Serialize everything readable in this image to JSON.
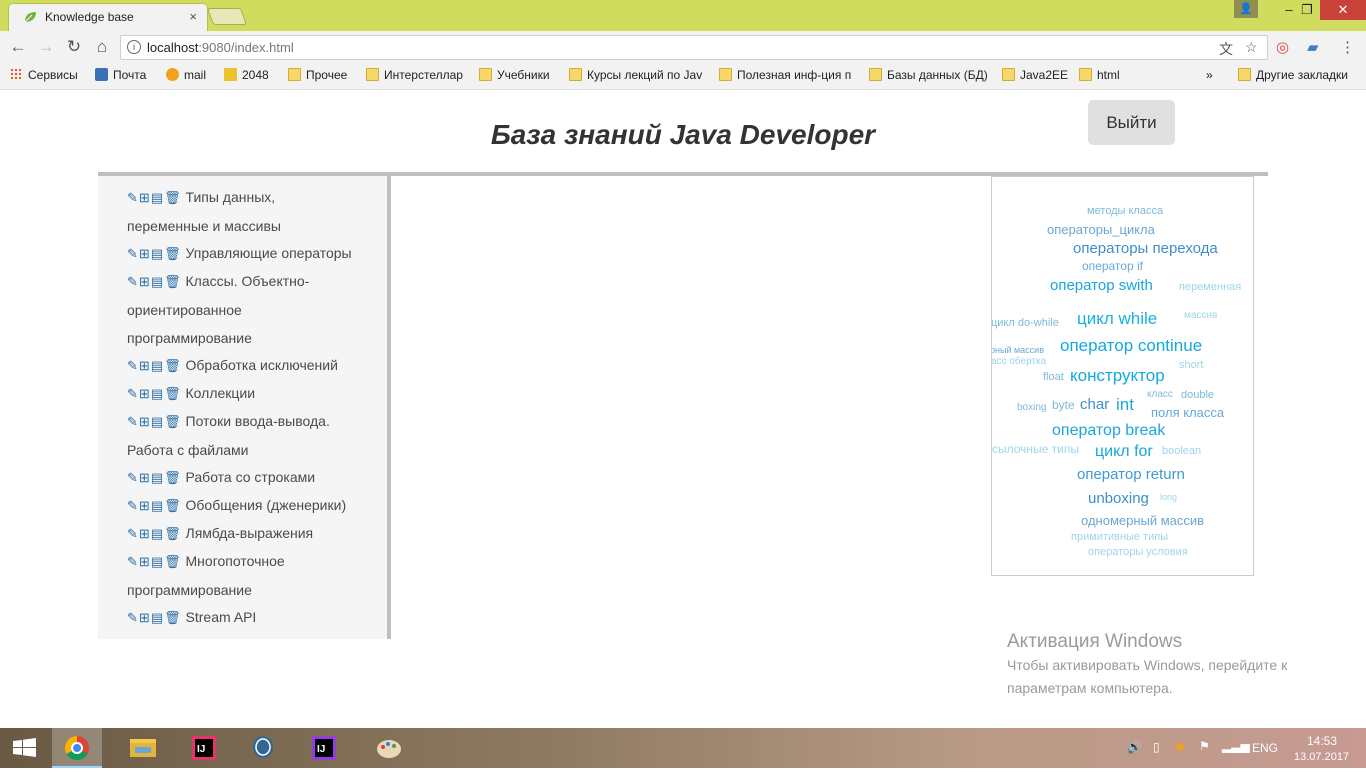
{
  "browser": {
    "tab_title": "Knowledge base",
    "tab_close": "×",
    "url_host": "localhost",
    "url_rest": ":9080/index.html",
    "bookmarks": [
      {
        "label": "Сервисы",
        "icon": "apps-icon"
      },
      {
        "label": "Почта",
        "icon": "mail-icon"
      },
      {
        "label": "mail",
        "icon": "at-icon"
      },
      {
        "label": "2048",
        "icon": "2048-icon"
      },
      {
        "label": "Прочее",
        "icon": "folder-icon"
      },
      {
        "label": "Интерстеллар",
        "icon": "folder-icon"
      },
      {
        "label": "Учебники",
        "icon": "folder-icon"
      },
      {
        "label": "Курсы лекций по Jav",
        "icon": "folder-icon"
      },
      {
        "label": "Полезная инф-ция п",
        "icon": "folder-icon"
      },
      {
        "label": "Базы данных (БД)",
        "icon": "folder-icon"
      },
      {
        "label": "Java2EE",
        "icon": "folder-icon"
      },
      {
        "label": "html",
        "icon": "folder-icon"
      }
    ],
    "more": "»",
    "other_bookmarks": "Другие закладки"
  },
  "page": {
    "title": "База знаний Java Developer",
    "logout": "Выйти",
    "categories": [
      {
        "line1": "Типы данных,",
        "line2": "переменные и массивы"
      },
      {
        "line1": "Управляющие операторы"
      },
      {
        "line1": "Классы. Объектно-",
        "line2": "ориентированное",
        "line3": "программирование"
      },
      {
        "line1": "Обработка исключений"
      },
      {
        "line1": "Коллекции"
      },
      {
        "line1": "Потоки ввода-вывода.",
        "line2": "Работа с файлами"
      },
      {
        "line1": "Работа со строками"
      },
      {
        "line1": "Обобщения (дженерики)"
      },
      {
        "line1": "Лямбда-выражения"
      },
      {
        "line1": "Многопоточное",
        "line2": "программирование"
      },
      {
        "line1": "Stream API"
      }
    ],
    "tag_cloud": [
      {
        "text": "методы класса",
        "color": "#7fb8dd"
      },
      {
        "text": "операторы_цикла",
        "color": "#6aa7d6"
      },
      {
        "text": "операторы перехода",
        "color": "#3e8ec9"
      },
      {
        "text": "оператор if",
        "color": "#6aa7d6"
      },
      {
        "text": "оператор swith",
        "color": "#1aa6dc"
      },
      {
        "text": "переменная",
        "color": "#9fd4ea"
      },
      {
        "text": "цикл do-while",
        "color": "#7fb8dd"
      },
      {
        "text": "цикл while",
        "color": "#1ab0e0"
      },
      {
        "text": "массив",
        "color": "#9fd4ea"
      },
      {
        "text": "рный массив",
        "color": "#6aa7d6"
      },
      {
        "text": "оператор continue",
        "color": "#12a9e0"
      },
      {
        "text": "асс обертка",
        "color": "#9fd4ea"
      },
      {
        "text": "short",
        "color": "#9fd4ea"
      },
      {
        "text": "float",
        "color": "#7fb8dd"
      },
      {
        "text": "конструктор",
        "color": "#12a9e0"
      },
      {
        "text": "класс",
        "color": "#7fb8dd"
      },
      {
        "text": "double",
        "color": "#7fb8dd"
      },
      {
        "text": "boxing",
        "color": "#7fb8dd"
      },
      {
        "text": "byte",
        "color": "#7fb8dd"
      },
      {
        "text": "char",
        "color": "#3e8ec9"
      },
      {
        "text": "int",
        "color": "#1aa6dc"
      },
      {
        "text": "поля класса",
        "color": "#6aa7d6"
      },
      {
        "text": "оператор break",
        "color": "#1aa6dc"
      },
      {
        "text": "ссылочные типы",
        "color": "#9fd4ea"
      },
      {
        "text": "цикл for",
        "color": "#1aa6dc"
      },
      {
        "text": "boolean",
        "color": "#9fd4ea"
      },
      {
        "text": "оператор return",
        "color": "#3e9ad0"
      },
      {
        "text": "unboxing",
        "color": "#3e8ec9"
      },
      {
        "text": "long",
        "color": "#9fd4ea"
      },
      {
        "text": "одномерный массив",
        "color": "#6aa7d6"
      },
      {
        "text": "примитивные типы",
        "color": "#9fd4ea"
      },
      {
        "text": "операторы условия",
        "color": "#9fd4ea"
      }
    ]
  },
  "watermark": {
    "heading": "Активация Windows",
    "line1": "Чтобы активировать Windows, перейдите к",
    "line2": "параметрам компьютера."
  },
  "taskbar": {
    "lang": "ENG",
    "time": "14:53",
    "date": "13.07.2017"
  }
}
